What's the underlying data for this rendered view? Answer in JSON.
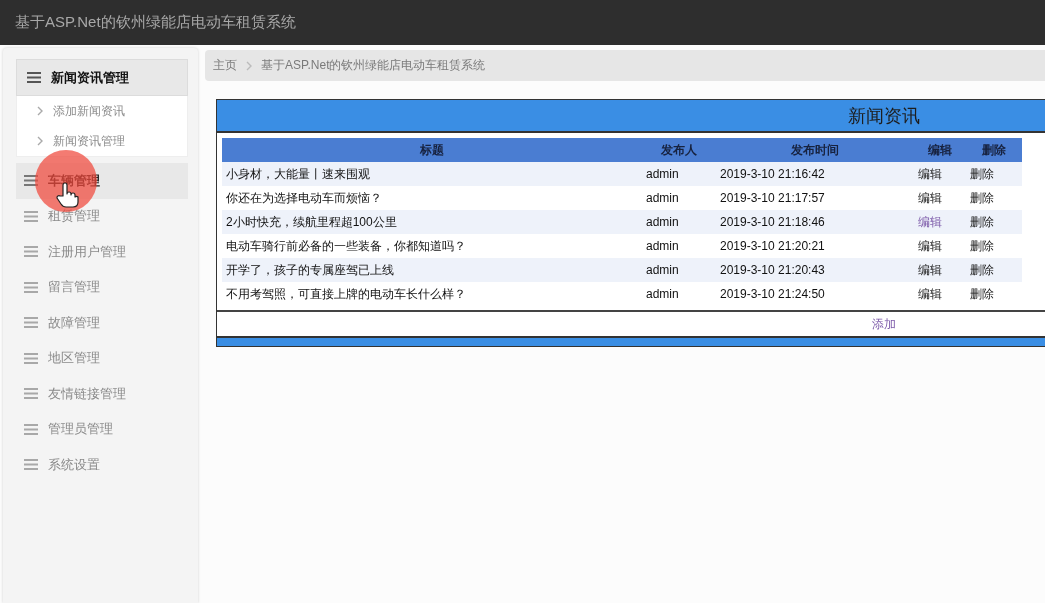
{
  "header": {
    "title": "基于ASP.Net的钦州绿能店电动车租赁系统"
  },
  "sidebar": {
    "items": [
      {
        "label": "新闻资讯管理",
        "expanded": true,
        "selected": false,
        "children": [
          {
            "label": "添加新闻资讯"
          },
          {
            "label": "新闻资讯管理"
          }
        ]
      },
      {
        "label": "车辆管理",
        "expanded": false,
        "selected": true
      },
      {
        "label": "租赁管理",
        "expanded": false,
        "selected": false
      },
      {
        "label": "注册用户管理",
        "expanded": false,
        "selected": false
      },
      {
        "label": "留言管理",
        "expanded": false,
        "selected": false
      },
      {
        "label": "故障管理",
        "expanded": false,
        "selected": false
      },
      {
        "label": "地区管理",
        "expanded": false,
        "selected": false
      },
      {
        "label": "友情链接管理",
        "expanded": false,
        "selected": false
      },
      {
        "label": "管理员管理",
        "expanded": false,
        "selected": false
      },
      {
        "label": "系统设置",
        "expanded": false,
        "selected": false
      }
    ]
  },
  "breadcrumb": [
    "主页",
    "基于ASP.Net的钦州绿能店电动车租赁系统"
  ],
  "panel": {
    "title": "新闻资讯",
    "table": {
      "columns": [
        "标题",
        "发布人",
        "发布时间",
        "编辑",
        "删除"
      ],
      "rows": [
        {
          "title": "小身材，大能量丨速来围观",
          "publisher": "admin",
          "time": "2019-3-10 21:16:42",
          "edit": {
            "label": "编辑",
            "visited": false
          },
          "delete": "删除"
        },
        {
          "title": "你还在为选择电动车而烦恼？",
          "publisher": "admin",
          "time": "2019-3-10 21:17:57",
          "edit": {
            "label": "编辑",
            "visited": false
          },
          "delete": "删除"
        },
        {
          "title": "2小时快充，续航里程超100公里",
          "publisher": "admin",
          "time": "2019-3-10 21:18:46",
          "edit": {
            "label": "编辑",
            "visited": true
          },
          "delete": "删除"
        },
        {
          "title": "电动车骑行前必备的一些装备，你都知道吗？",
          "publisher": "admin",
          "time": "2019-3-10 21:20:21",
          "edit": {
            "label": "编辑",
            "visited": false
          },
          "delete": "删除"
        },
        {
          "title": "开学了，孩子的专属座驾已上线",
          "publisher": "admin",
          "time": "2019-3-10 21:20:43",
          "edit": {
            "label": "编辑",
            "visited": false
          },
          "delete": "删除"
        },
        {
          "title": "不用考驾照，可直接上牌的电动车长什么样？",
          "publisher": "admin",
          "time": "2019-3-10 21:24:50",
          "edit": {
            "label": "编辑",
            "visited": false
          },
          "delete": "删除"
        }
      ]
    },
    "add": {
      "label": "添加",
      "visited": true
    }
  }
}
